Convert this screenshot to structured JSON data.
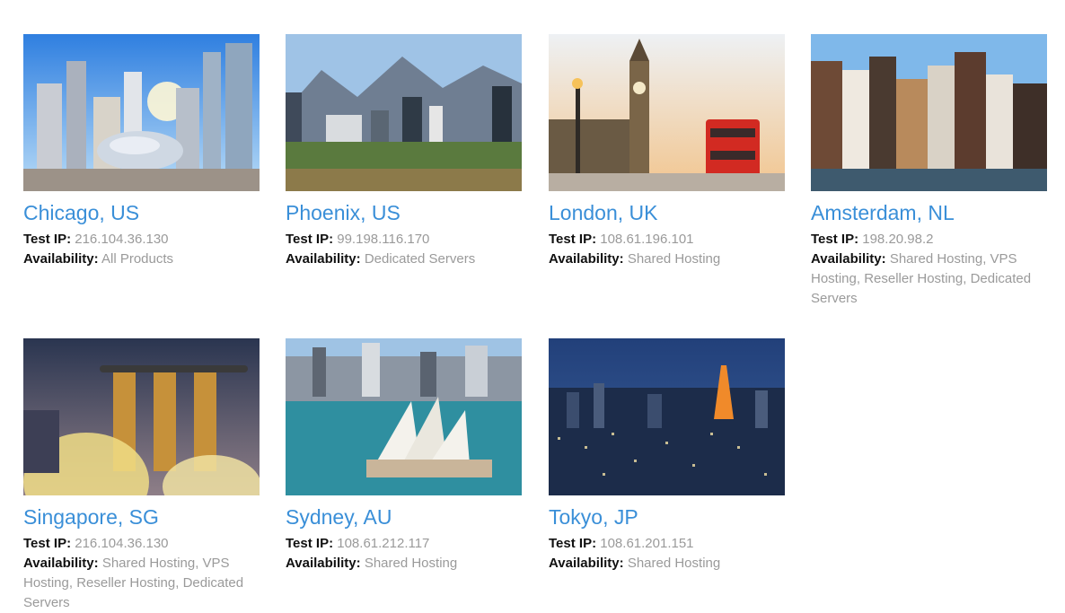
{
  "labels": {
    "test_ip": "Test IP:",
    "availability": "Availability:"
  },
  "accent_color": "#3a8fd8",
  "locations": [
    {
      "city": "Chicago, US",
      "ip": "216.104.36.130",
      "availability": "All Products",
      "photo": "chicago-skyline-image"
    },
    {
      "city": "Phoenix, US",
      "ip": "99.198.116.170",
      "availability": "Dedicated Servers",
      "photo": "phoenix-skyline-image"
    },
    {
      "city": "London, UK",
      "ip": "108.61.196.101",
      "availability": "Shared Hosting",
      "photo": "london-big-ben-image"
    },
    {
      "city": "Amsterdam, NL",
      "ip": "198.20.98.2",
      "availability": "Shared Hosting, VPS Hosting, Reseller Hosting, Dedicated Servers",
      "photo": "amsterdam-canal-houses-image"
    },
    {
      "city": "Singapore, SG",
      "ip": "216.104.36.130",
      "availability": "Shared Hosting, VPS Hosting, Reseller Hosting, Dedicated Servers",
      "photo": "singapore-marina-bay-image"
    },
    {
      "city": "Sydney, AU",
      "ip": "108.61.212.117",
      "availability": "Shared Hosting",
      "photo": "sydney-opera-house-image"
    },
    {
      "city": "Tokyo, JP",
      "ip": "108.61.201.151",
      "availability": "Shared Hosting",
      "photo": "tokyo-night-city-image"
    }
  ]
}
